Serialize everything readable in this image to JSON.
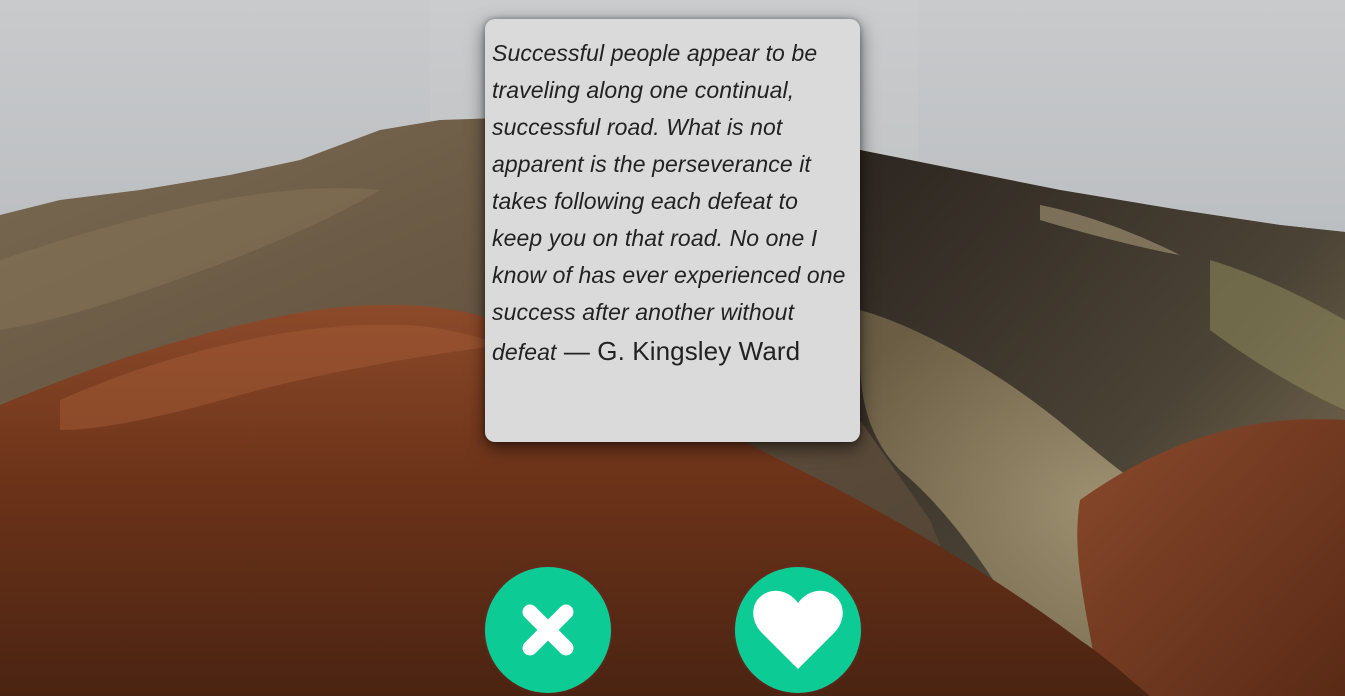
{
  "background": {
    "description_icon": "mountain-landscape-image",
    "colors": {
      "sky": "#b6babd",
      "foreground_hill": "#6e3217",
      "back_hill": "#6b5a45",
      "right_slope": "#3c342c"
    }
  },
  "quote": {
    "text": "Successful people appear to be traveling along one continual, successful road. What is not apparent is the perseverance it takes following each defeat to keep you on that road. No one I know of has ever experienced one success after another without defeat",
    "separator": " — ",
    "author": "G. Kingsley Ward"
  },
  "actions": {
    "reject": {
      "icon": "close-icon",
      "color": "#0ccb94"
    },
    "like": {
      "icon": "heart-icon",
      "color": "#0ccb94"
    }
  }
}
